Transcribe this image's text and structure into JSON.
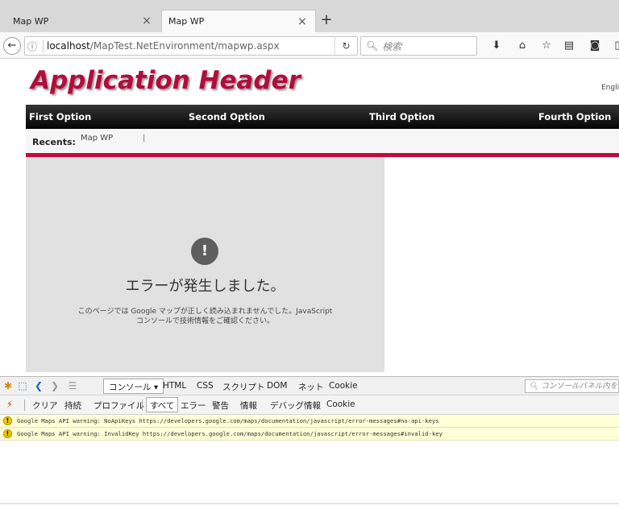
{
  "browser": {
    "tabs": [
      {
        "title": "Map WP",
        "active": false
      },
      {
        "title": "Map WP",
        "active": true
      }
    ],
    "new_tab_symbol": "+",
    "close_symbol": "×",
    "url_host": "localhost",
    "url_path": "/MapTest.NetEnvironment/mapwp.aspx",
    "search_placeholder": "検索",
    "toolbar_icons": [
      "download-icon",
      "home-icon",
      "bookmark-star-icon",
      "reading-list-icon",
      "pocket-icon"
    ]
  },
  "page": {
    "app_header": "Application Header",
    "language": "Engli",
    "menu": [
      "First Option",
      "Second Option",
      "Third Option",
      "Fourth Option"
    ],
    "recents_label": "Recents:",
    "recents_items": [
      "Map WP"
    ],
    "recents_separator": "|",
    "map_error": {
      "icon": "!",
      "title": "エラーが発生しました。",
      "desc_line1": "このページでは Google マップが正しく読み込まれませんでした。JavaScript",
      "desc_line2": "コンソールで技術情報をご確認ください。"
    }
  },
  "firebug": {
    "tabs": [
      "コンソール ▾",
      "HTML",
      "CSS",
      "スクリプト",
      "DOM",
      "ネット",
      "Cookie"
    ],
    "search_placeholder": "コンソールパネル内を検",
    "subtoolbar": [
      "クリア",
      "持続",
      "プロファイル",
      "すべて",
      "エラー",
      "警告",
      "情報",
      "デバッグ情報",
      "Cookie"
    ],
    "messages": [
      "Google Maps API warning: NoApiKeys https://developers.google.com/maps/documentation/javascript/error-messages#no-api-keys",
      "Google Maps API warning: InvalidKey https://developers.google.com/maps/documentation/javascript/error-messages#invalid-key"
    ]
  },
  "colors": {
    "brand_red": "#b10d3c",
    "accent_bar": "#c4093c",
    "menu_bg": "#050505",
    "map_bg": "#e1e1e1",
    "warning_bg": "#ffffd8"
  }
}
